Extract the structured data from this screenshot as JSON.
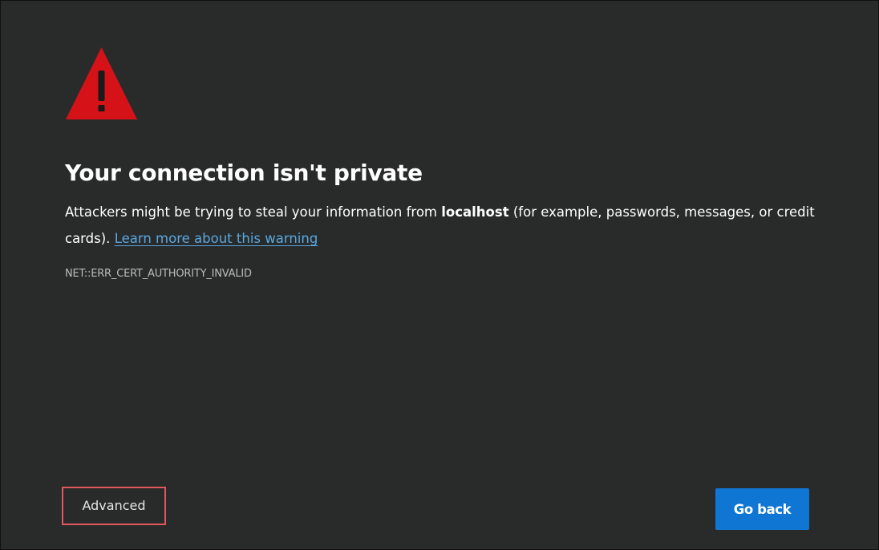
{
  "page": {
    "title": "Your connection isn't private",
    "description": {
      "before_host": "Attackers might be trying to steal your information from ",
      "host": "localhost",
      "after_host": " (for example, passwords, messages, or credit cards). ",
      "link_text": "Learn more about this warning"
    },
    "error_code": "NET::ERR_CERT_AUTHORITY_INVALID"
  },
  "buttons": {
    "advanced_label": "Advanced",
    "go_back_label": "Go back"
  },
  "icons": {
    "warning": "warning-triangle-icon"
  },
  "colors": {
    "background": "#292b2a",
    "warning_red": "#d41217",
    "link_blue": "#5aa7e0",
    "primary_button": "#0f76d4",
    "highlight_border": "#e25660",
    "error_code_text": "#b9bcba"
  }
}
